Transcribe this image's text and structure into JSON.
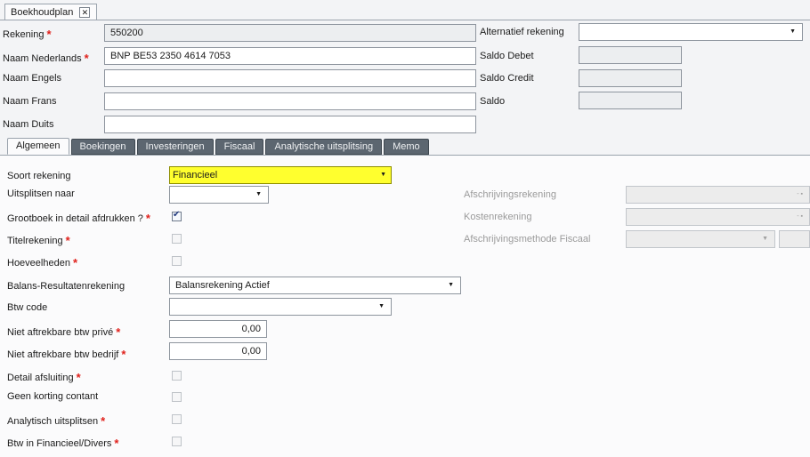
{
  "document_tab": {
    "title": "Boekhoudplan",
    "close_glyph": "✕"
  },
  "header": {
    "rekening": {
      "label": "Rekening",
      "value": "550200"
    },
    "naam_nl": {
      "label": "Naam Nederlands",
      "value": "BNP BE53 2350 4614 7053"
    },
    "naam_en": {
      "label": "Naam Engels",
      "value": ""
    },
    "naam_fr": {
      "label": "Naam Frans",
      "value": ""
    },
    "naam_de": {
      "label": "Naam Duits",
      "value": ""
    },
    "alternatief": {
      "label": "Alternatief rekening",
      "value": ""
    },
    "saldo_debet": {
      "label": "Saldo Debet",
      "value": ""
    },
    "saldo_credit": {
      "label": "Saldo Credit",
      "value": ""
    },
    "saldo": {
      "label": "Saldo",
      "value": ""
    }
  },
  "tabs": [
    "Algemeen",
    "Boekingen",
    "Investeringen",
    "Fiscaal",
    "Analytische uitsplitsing",
    "Memo"
  ],
  "general": {
    "soort_rekening": {
      "label": "Soort rekening",
      "value": "Financieel"
    },
    "uitsplitsen_naar": {
      "label": "Uitsplitsen naar",
      "value": ""
    },
    "grootboek_detail": {
      "label": "Grootboek in detail afdrukken ?",
      "checked": true
    },
    "titelrekening": {
      "label": "Titelrekening",
      "checked": false
    },
    "hoeveelheden": {
      "label": "Hoeveelheden",
      "checked": false
    },
    "balans_resultaten": {
      "label": "Balans-Resultatenrekening",
      "value": "Balansrekening Actief"
    },
    "btw_code": {
      "label": "Btw code",
      "value": ""
    },
    "niet_aftrek_prive": {
      "label": "Niet aftrekbare btw privé",
      "value": "0,00"
    },
    "niet_aftrek_bedrijf": {
      "label": "Niet aftrekbare btw bedrijf",
      "value": "0,00"
    },
    "detail_afsluiting": {
      "label": "Detail afsluiting",
      "checked": false
    },
    "geen_korting": {
      "label": "Geen korting contant",
      "checked": false
    },
    "analytisch": {
      "label": "Analytisch uitsplitsen",
      "checked": false
    },
    "btw_financieel": {
      "label": "Btw in Financieel/Divers",
      "checked": false
    },
    "afschrijvingsrekening": {
      "label": "Afschrijvingsrekening",
      "value": ""
    },
    "kostenrekening": {
      "label": "Kostenrekening",
      "value": ""
    },
    "afschrijvingsmethode": {
      "label": "Afschrijvingsmethode Fiscaal",
      "value": ""
    }
  },
  "glyphs": {
    "required": "*",
    "dropdown": "▼",
    "dropdown_ellipsis": "- ▪"
  },
  "colors": {
    "highlight": "#ffff2e",
    "required": "#e0211c",
    "tab_inactive": "#5c6670"
  }
}
